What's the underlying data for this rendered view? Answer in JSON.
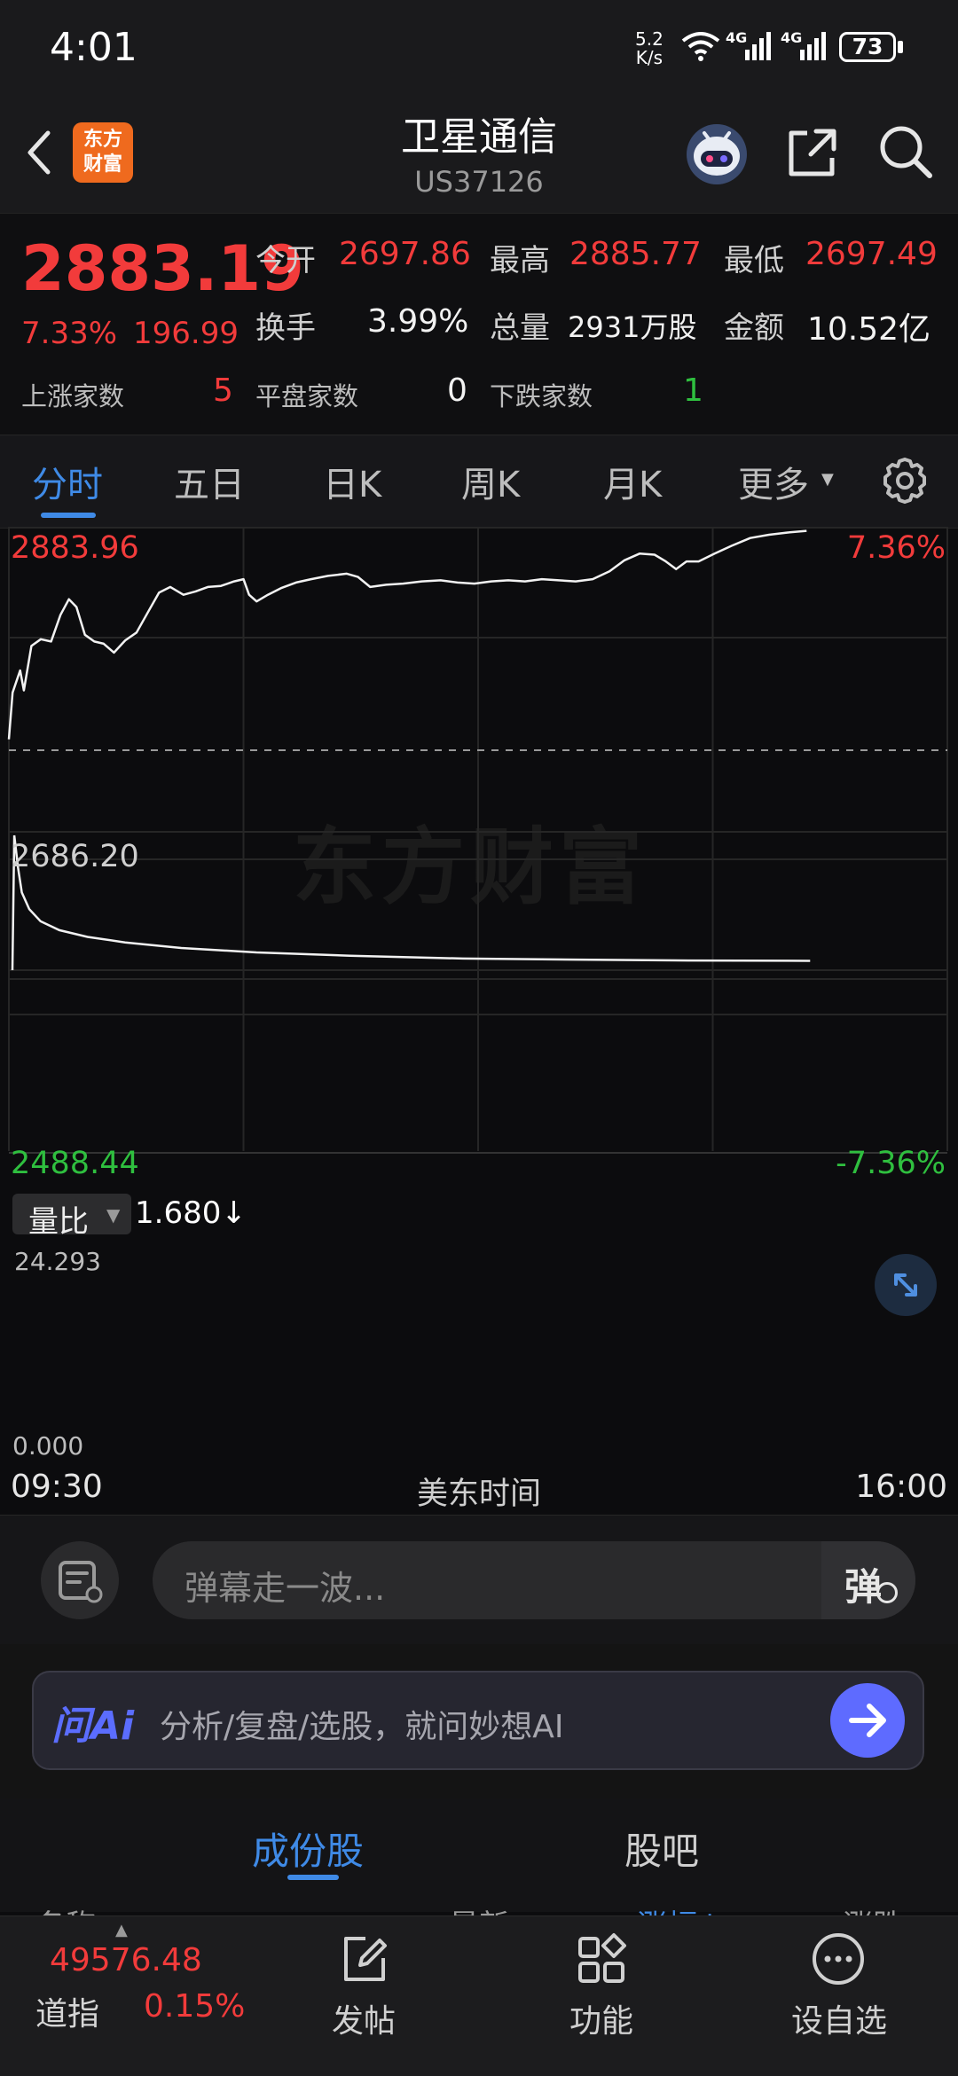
{
  "status_bar": {
    "time": "4:01",
    "net_speed_value": "5.2",
    "net_speed_unit": "K/s",
    "signal_label_1": "4G",
    "signal_label_2": "4G",
    "battery": "73"
  },
  "header": {
    "logo_line1": "东方",
    "logo_line2": "财富",
    "title": "卫星通信",
    "code": "US37126",
    "icons": [
      "back-arrow-icon",
      "robot-icon",
      "share-icon",
      "search-icon"
    ]
  },
  "quote": {
    "price": "2883.19",
    "change_pct": "7.33%",
    "change": "196.99",
    "open_label": "今开",
    "open": "2697.86",
    "high_label": "最高",
    "high": "2885.77",
    "low_label": "最低",
    "low": "2697.49",
    "turnover_label": "换手",
    "turnover": "3.99%",
    "volume_label": "总量",
    "volume": "2931万股",
    "amount_label": "金额",
    "amount": "10.52亿",
    "up_label": "上涨家数",
    "up_count": "5",
    "flat_label": "平盘家数",
    "flat_count": "0",
    "down_label": "下跌家数",
    "down_count": "1"
  },
  "tabs": [
    "分时",
    "五日",
    "日K",
    "周K",
    "月K",
    "更多"
  ],
  "chart": {
    "watermark": "东方财富",
    "y_top": "2883.96",
    "y_mid": "2686.20",
    "y_bottom": "2488.44",
    "pct_top": "7.36%",
    "pct_bottom": "-7.36%",
    "vol_label": "量比",
    "vol_value": "1.680",
    "vol_arrow": "↓",
    "vol_top": "24.293",
    "vol_bottom": "0.000",
    "time_start": "09:30",
    "time_zone": "美东时间",
    "time_end": "16:00"
  },
  "chart_data": {
    "type": "line",
    "x_range": [
      "09:30",
      "16:00"
    ],
    "ylim": [
      2488.44,
      2883.96
    ],
    "reference": 2686.2,
    "price_series": [
      {
        "t": 0.0,
        "v": 2696
      },
      {
        "t": 0.004,
        "v": 2738
      },
      {
        "t": 0.012,
        "v": 2758
      },
      {
        "t": 0.016,
        "v": 2740
      },
      {
        "t": 0.024,
        "v": 2780
      },
      {
        "t": 0.034,
        "v": 2786
      },
      {
        "t": 0.045,
        "v": 2784
      },
      {
        "t": 0.055,
        "v": 2808
      },
      {
        "t": 0.064,
        "v": 2822
      },
      {
        "t": 0.072,
        "v": 2815
      },
      {
        "t": 0.081,
        "v": 2790
      },
      {
        "t": 0.091,
        "v": 2784
      },
      {
        "t": 0.101,
        "v": 2782
      },
      {
        "t": 0.112,
        "v": 2774
      },
      {
        "t": 0.124,
        "v": 2785
      },
      {
        "t": 0.136,
        "v": 2792
      },
      {
        "t": 0.148,
        "v": 2810
      },
      {
        "t": 0.16,
        "v": 2828
      },
      {
        "t": 0.172,
        "v": 2833
      },
      {
        "t": 0.186,
        "v": 2826
      },
      {
        "t": 0.199,
        "v": 2829
      },
      {
        "t": 0.212,
        "v": 2833
      },
      {
        "t": 0.226,
        "v": 2834
      },
      {
        "t": 0.24,
        "v": 2838
      },
      {
        "t": 0.25,
        "v": 2840
      },
      {
        "t": 0.256,
        "v": 2826
      },
      {
        "t": 0.264,
        "v": 2820
      },
      {
        "t": 0.276,
        "v": 2826
      },
      {
        "t": 0.29,
        "v": 2832
      },
      {
        "t": 0.306,
        "v": 2837
      },
      {
        "t": 0.322,
        "v": 2840
      },
      {
        "t": 0.34,
        "v": 2843
      },
      {
        "t": 0.36,
        "v": 2845
      },
      {
        "t": 0.372,
        "v": 2842
      },
      {
        "t": 0.385,
        "v": 2833
      },
      {
        "t": 0.402,
        "v": 2835
      },
      {
        "t": 0.42,
        "v": 2836
      },
      {
        "t": 0.44,
        "v": 2838
      },
      {
        "t": 0.46,
        "v": 2839
      },
      {
        "t": 0.478,
        "v": 2837
      },
      {
        "t": 0.496,
        "v": 2836
      },
      {
        "t": 0.514,
        "v": 2838
      },
      {
        "t": 0.532,
        "v": 2839
      },
      {
        "t": 0.55,
        "v": 2838
      },
      {
        "t": 0.568,
        "v": 2840
      },
      {
        "t": 0.586,
        "v": 2839
      },
      {
        "t": 0.604,
        "v": 2838
      },
      {
        "t": 0.622,
        "v": 2840
      },
      {
        "t": 0.64,
        "v": 2847
      },
      {
        "t": 0.656,
        "v": 2857
      },
      {
        "t": 0.672,
        "v": 2863
      },
      {
        "t": 0.688,
        "v": 2862
      },
      {
        "t": 0.7,
        "v": 2856
      },
      {
        "t": 0.711,
        "v": 2849
      },
      {
        "t": 0.722,
        "v": 2856
      },
      {
        "t": 0.735,
        "v": 2856
      },
      {
        "t": 0.752,
        "v": 2863
      },
      {
        "t": 0.77,
        "v": 2870
      },
      {
        "t": 0.79,
        "v": 2877
      },
      {
        "t": 0.81,
        "v": 2880
      },
      {
        "t": 0.83,
        "v": 2882
      },
      {
        "t": 0.85,
        "v": 2883.5
      }
    ],
    "volume_ratio_series": [
      {
        "t": 0.0,
        "v": 0
      },
      {
        "t": 0.002,
        "v": 24.29
      },
      {
        "t": 0.006,
        "v": 18.5
      },
      {
        "t": 0.01,
        "v": 14.0
      },
      {
        "t": 0.018,
        "v": 11.0
      },
      {
        "t": 0.03,
        "v": 8.8
      },
      {
        "t": 0.05,
        "v": 7.2
      },
      {
        "t": 0.08,
        "v": 6.0
      },
      {
        "t": 0.12,
        "v": 5.0
      },
      {
        "t": 0.18,
        "v": 4.0
      },
      {
        "t": 0.26,
        "v": 3.2
      },
      {
        "t": 0.36,
        "v": 2.6
      },
      {
        "t": 0.48,
        "v": 2.1
      },
      {
        "t": 0.6,
        "v": 1.9
      },
      {
        "t": 0.72,
        "v": 1.75
      },
      {
        "t": 0.85,
        "v": 1.68
      }
    ],
    "vol_ylim": [
      0,
      24.293
    ]
  },
  "danmu": {
    "placeholder": "弹幕走一波...",
    "button": "弹"
  },
  "ai": {
    "logo": "问Ai",
    "text": "分析/复盘/选股，就问妙想AI"
  },
  "sub_tabs": [
    "成份股",
    "股吧"
  ],
  "sub_header_peek": [
    "名称",
    "最新",
    "涨幅↓",
    "涨跌"
  ],
  "bottom_nav": {
    "index_value": "49576.48",
    "index_name": "道指",
    "index_pct": "0.15%",
    "items": [
      "发帖",
      "功能",
      "设自选"
    ]
  },
  "colors": {
    "up": "#f23b3b",
    "down": "#2fbf3f",
    "accent": "#3f8ae6",
    "ai_accent": "#5e6bff",
    "background": "#0c0c0e"
  }
}
